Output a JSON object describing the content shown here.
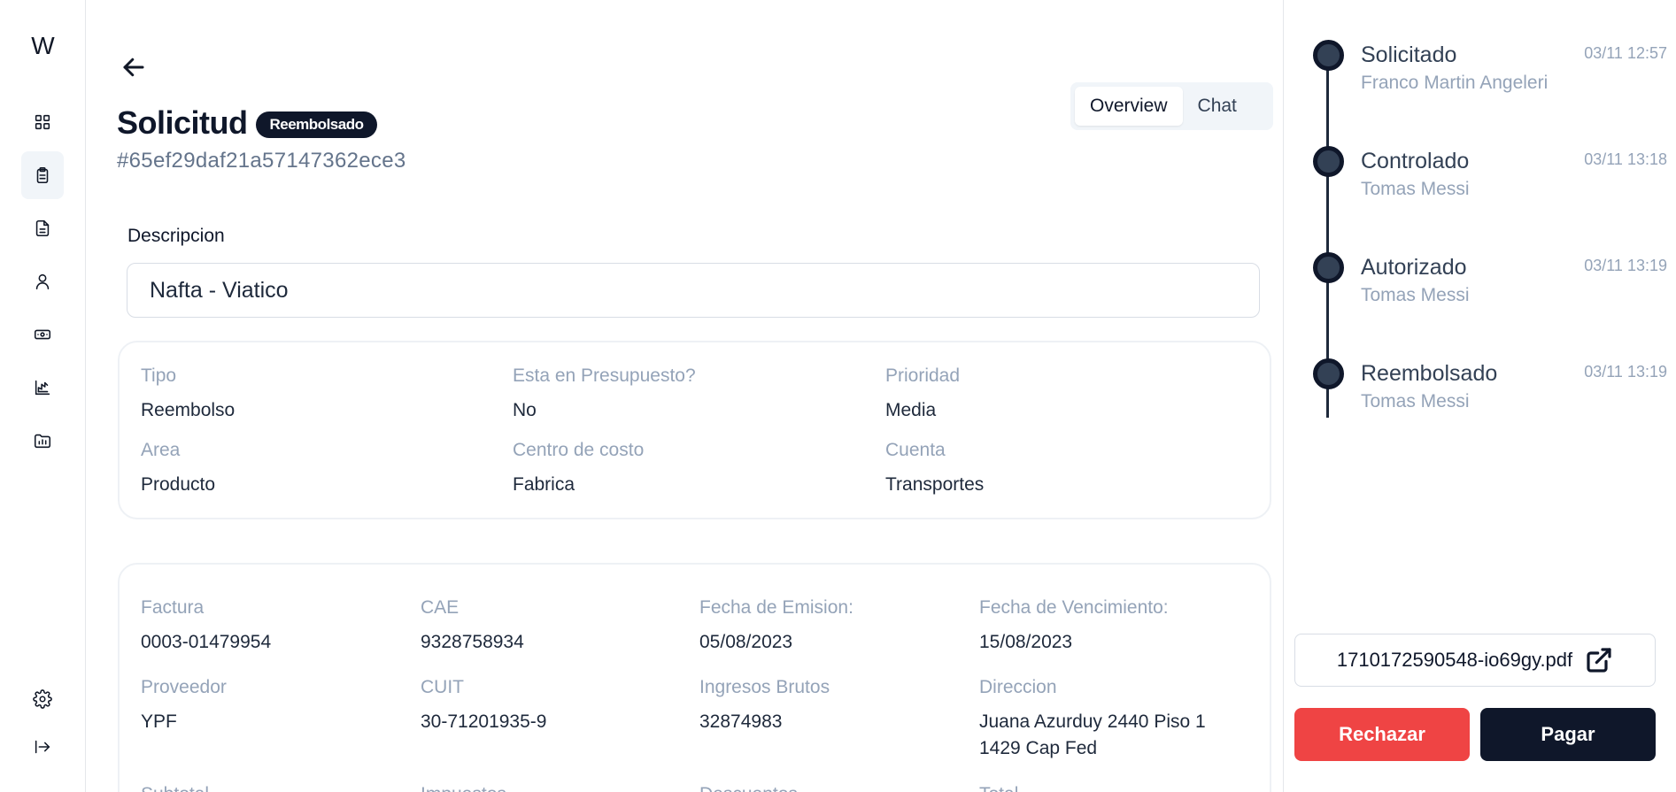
{
  "app": {
    "logo": "W"
  },
  "sidebar": {
    "items": [
      {
        "name": "dashboard",
        "icon": "grid-icon"
      },
      {
        "name": "requests",
        "icon": "clipboard-icon",
        "active": true
      },
      {
        "name": "documents",
        "icon": "file-text-icon"
      },
      {
        "name": "users",
        "icon": "user-icon"
      },
      {
        "name": "payments",
        "icon": "banknote-icon"
      },
      {
        "name": "reports",
        "icon": "chart-icon"
      },
      {
        "name": "folders",
        "icon": "folder-chart-icon"
      }
    ],
    "bottom": [
      {
        "name": "settings",
        "icon": "gear-icon"
      },
      {
        "name": "logout",
        "icon": "logout-icon"
      }
    ]
  },
  "header": {
    "title": "Solicitud",
    "status_badge": "Reembolsado",
    "request_id": "#65ef29daf21a57147362ece3",
    "tabs": [
      {
        "label": "Overview",
        "active": true
      },
      {
        "label": "Chat",
        "active": false
      }
    ]
  },
  "description": {
    "label": "Descripcion",
    "value": "Nafta - Viatico"
  },
  "details": {
    "tipo_label": "Tipo",
    "tipo": "Reembolso",
    "presupuesto_label": "Esta en Presupuesto?",
    "presupuesto": "No",
    "prioridad_label": "Prioridad",
    "prioridad": "Media",
    "area_label": "Area",
    "area": "Producto",
    "centro_label": "Centro de costo",
    "centro": "Fabrica",
    "cuenta_label": "Cuenta",
    "cuenta": "Transportes"
  },
  "invoice": {
    "factura_label": "Factura",
    "factura": "0003-01479954",
    "cae_label": "CAE",
    "cae": "9328758934",
    "emision_label": "Fecha de Emision:",
    "emision": "05/08/2023",
    "vencimiento_label": "Fecha de Vencimiento:",
    "vencimiento": "15/08/2023",
    "proveedor_label": "Proveedor",
    "proveedor": "YPF",
    "cuit_label": "CUIT",
    "cuit": "30-71201935-9",
    "ingresos_label": "Ingresos Brutos",
    "ingresos": "32874983",
    "direccion_label": "Direccion",
    "direccion": "Juana Azurduy 2440 Piso 1 1429 Cap Fed",
    "subtotal_label": "Subtotal",
    "impuestos_label": "Impuestos",
    "descuentos_label": "Descuentos",
    "total_label": "Total"
  },
  "timeline": [
    {
      "status": "Solicitado",
      "user": "Franco Martin Angeleri",
      "time": "03/11 12:57"
    },
    {
      "status": "Controlado",
      "user": "Tomas Messi",
      "time": "03/11 13:18"
    },
    {
      "status": "Autorizado",
      "user": "Tomas Messi",
      "time": "03/11 13:19"
    },
    {
      "status": "Reembolsado",
      "user": "Tomas Messi",
      "time": "03/11 13:19"
    }
  ],
  "attachment": {
    "filename": "1710172590548-io69gy.pdf",
    "icon": "external-link-icon"
  },
  "actions": {
    "reject_label": "Rechazar",
    "pay_label": "Pagar"
  },
  "colors": {
    "primary": "#0f172a",
    "danger": "#ef4444",
    "muted": "#94a3b8"
  }
}
